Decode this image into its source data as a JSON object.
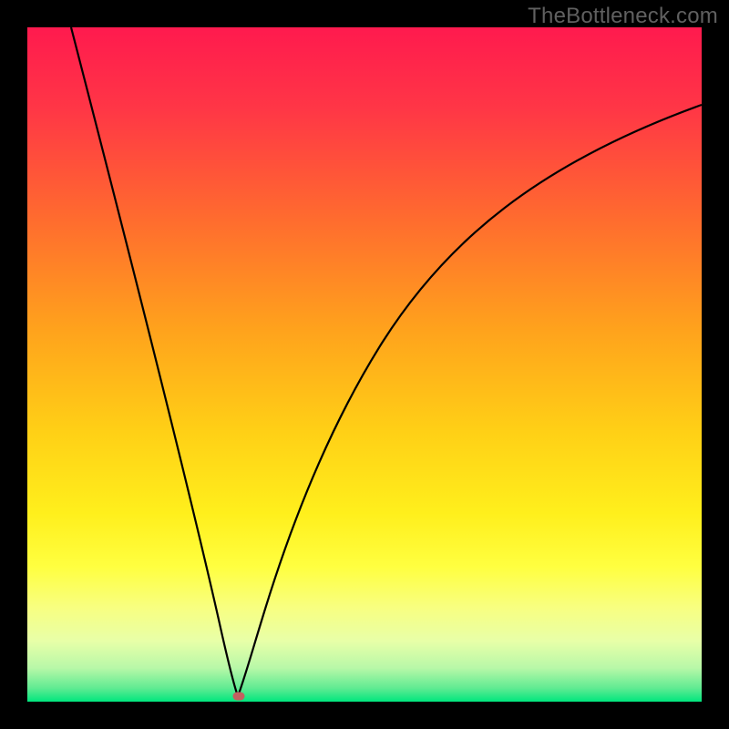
{
  "watermark": "TheBottleneck.com",
  "marker": {
    "x_frac": 0.313,
    "y_frac": 0.992
  },
  "chart_data": {
    "type": "line",
    "title": "",
    "xlabel": "",
    "ylabel": "",
    "xlim": [
      0,
      1
    ],
    "ylim": [
      0,
      1
    ],
    "x": [
      0.0,
      0.05,
      0.1,
      0.15,
      0.2,
      0.25,
      0.3,
      0.313,
      0.35,
      0.4,
      0.45,
      0.5,
      0.55,
      0.6,
      0.65,
      0.7,
      0.75,
      0.8,
      0.85,
      0.9,
      0.95,
      1.0
    ],
    "values": [
      1.0,
      0.84,
      0.68,
      0.52,
      0.36,
      0.2,
      0.04,
      0.0,
      0.15,
      0.31,
      0.44,
      0.55,
      0.63,
      0.7,
      0.76,
      0.8,
      0.83,
      0.85,
      0.87,
      0.88,
      0.89,
      0.89
    ],
    "gradient_colors_top_to_bottom": [
      "#ff1a4e",
      "#ff6a2f",
      "#ffb019",
      "#ffe018",
      "#ffff40",
      "#f6ff8f",
      "#d9ffb0",
      "#84f29a",
      "#00e67e"
    ],
    "marker_color": "#c36060",
    "curves": [
      {
        "name": "left-descent",
        "description": "near-linear steep descent from top-left to minimum",
        "x_range": [
          0.0,
          0.313
        ]
      },
      {
        "name": "right-ascent",
        "description": "decelerating rise (concave) from minimum toward upper-mid right",
        "x_range": [
          0.313,
          1.0
        ]
      }
    ]
  }
}
